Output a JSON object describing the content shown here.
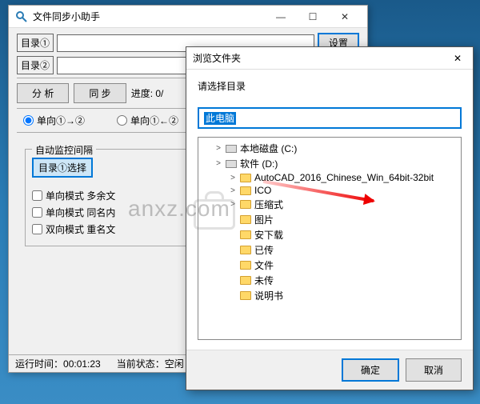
{
  "main": {
    "title": "文件同步小助手",
    "dir1_label": "目录①",
    "dir2_label": "目录②",
    "settings_btn": "设置",
    "analyze_btn": "分 析",
    "sync_btn": "同 步",
    "progress_label": "进度: 0/",
    "radio1": "单向①→②",
    "radio2": "单向①←②",
    "fieldset_legend": "自动监控间隔",
    "select_btn": "目录①选择",
    "chk1": "单向模式 多余文",
    "chk2": "单向模式 同名内",
    "chk3": "双向模式 重名文",
    "status_runtime_label": "运行时间：",
    "status_runtime_value": "00:01:23",
    "status_state_label": "当前状态：",
    "status_state_value": "空闲"
  },
  "browse": {
    "title": "浏览文件夹",
    "prompt": "请选择目录",
    "path_value": "此电脑",
    "items": [
      {
        "level": 1,
        "expander": ">",
        "icon": "disk",
        "label": "本地磁盘 (C:)"
      },
      {
        "level": 1,
        "expander": ">",
        "icon": "disk",
        "label": "软件 (D:)"
      },
      {
        "level": 2,
        "expander": ">",
        "icon": "folder",
        "label": "AutoCAD_2016_Chinese_Win_64bit-32bit"
      },
      {
        "level": 2,
        "expander": ">",
        "icon": "folder",
        "label": "ICO"
      },
      {
        "level": 2,
        "expander": ">",
        "icon": "folder",
        "label": "压缩式"
      },
      {
        "level": 2,
        "expander": "",
        "icon": "folder",
        "label": "图片"
      },
      {
        "level": 2,
        "expander": "",
        "icon": "folder",
        "label": "安下载"
      },
      {
        "level": 2,
        "expander": "",
        "icon": "folder",
        "label": "已传"
      },
      {
        "level": 2,
        "expander": "",
        "icon": "folder",
        "label": "文件"
      },
      {
        "level": 2,
        "expander": "",
        "icon": "folder",
        "label": "未传"
      },
      {
        "level": 2,
        "expander": "",
        "icon": "folder",
        "label": "说明书"
      }
    ],
    "ok_btn": "确定",
    "cancel_btn": "取消"
  },
  "watermark": "anxz.com"
}
